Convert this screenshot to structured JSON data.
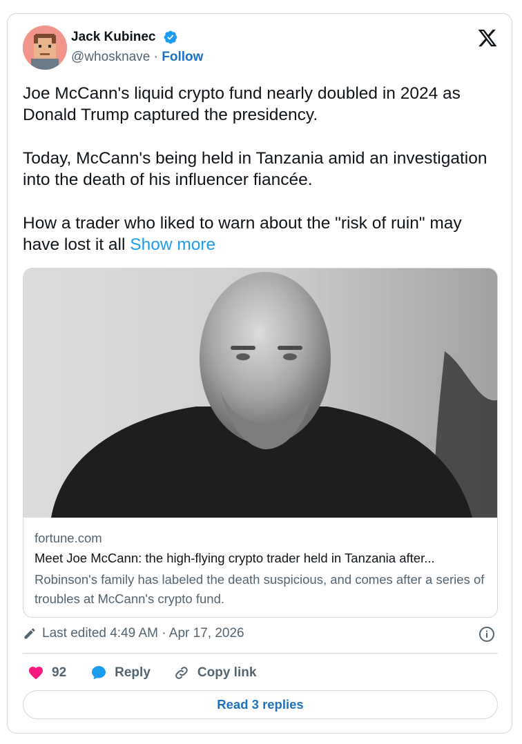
{
  "author": {
    "name": "Jack Kubinec",
    "handle": "@whosknave",
    "separator": " · ",
    "follow_label": "Follow"
  },
  "tweet": {
    "paragraphs": [
      "Joe McCann's liquid crypto fund nearly doubled in 2024 as Donald Trump captured the presidency.",
      "Today, McCann's being held in Tanzania amid an investigation into the death of his influencer fiancée.",
      "How a trader who liked to warn about the \"risk of ruin\" may have lost it all "
    ],
    "show_more": "Show more"
  },
  "link_card": {
    "domain": "fortune.com",
    "title": "Meet Joe McCann: the high-flying crypto trader held in Tanzania after...",
    "description": "Robinson's family has labeled the death suspicious, and comes after a series of troubles at McCann's crypto fund."
  },
  "meta": {
    "edited": "Last edited 4:49 AM · Apr 17, 2026"
  },
  "actions": {
    "like_count": "92",
    "reply_label": "Reply",
    "copy_link_label": "Copy link"
  },
  "read_replies_label": "Read 3 replies",
  "colors": {
    "link_blue": "#1d9bf0",
    "follow_blue": "#1d71c2",
    "heart_pink": "#f91880",
    "verified_blue": "#1d9bf0",
    "muted": "#536471",
    "text": "#0f1419"
  },
  "icons": [
    "x-logo-icon",
    "verified-badge-icon",
    "pencil-icon",
    "info-icon",
    "heart-icon",
    "reply-bubble-icon",
    "link-icon"
  ]
}
